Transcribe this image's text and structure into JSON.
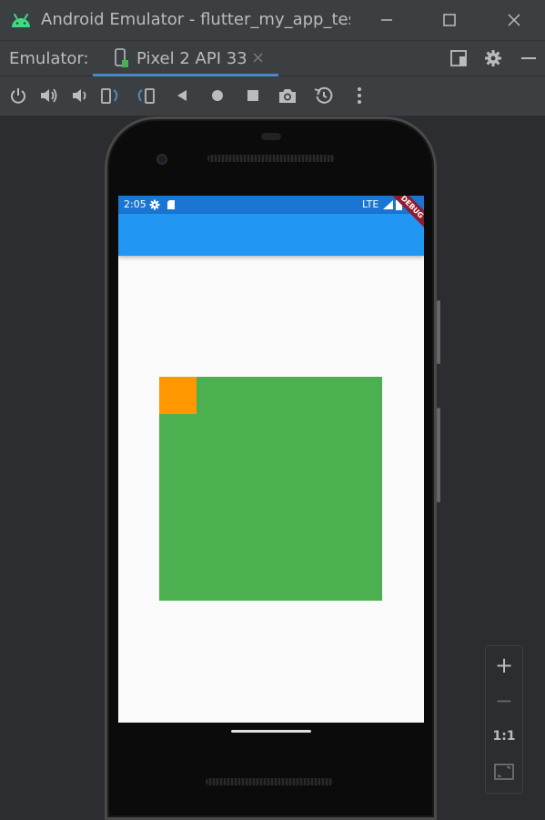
{
  "window": {
    "title": "Android Emulator - flutter_my_app_test",
    "icon": "android-icon",
    "controls": [
      "minimize-icon",
      "maximize-icon",
      "close-icon"
    ]
  },
  "emulator_bar": {
    "label": "Emulator:",
    "tab": {
      "label": "Pixel 2 API 33",
      "close": "×"
    },
    "actions": [
      "layout-icon",
      "gear-icon",
      "minimize-icon"
    ]
  },
  "toolbar": {
    "items": [
      "power-icon",
      "volume-up-icon",
      "volume-down-icon",
      "rotate-left-icon",
      "rotate-right-icon",
      "back-icon",
      "home-icon",
      "overview-icon",
      "camera-icon",
      "snapshot-icon",
      "more-icon"
    ]
  },
  "device": {
    "status_bar": {
      "time": "2:05",
      "network": "LTE",
      "color": "#1976d2"
    },
    "app_bar": {
      "color": "#2196f3"
    },
    "debug_banner": "DEBUG",
    "content": {
      "outer_box_color": "#4caf50",
      "inner_box_color": "#ff9800",
      "background": "#fafafa"
    }
  },
  "zoom_panel": {
    "zoom_in": "+",
    "zoom_out": "−",
    "actual_size": "1:1",
    "fit_icon": "fit-screen-icon"
  }
}
